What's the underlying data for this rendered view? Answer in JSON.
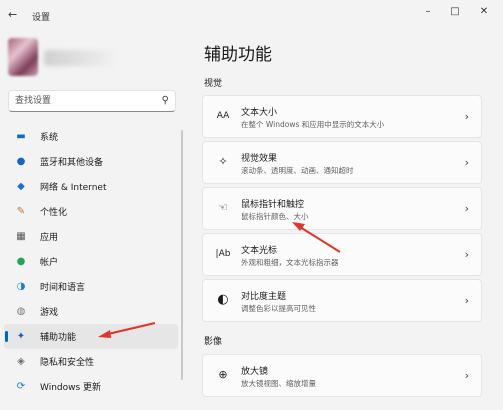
{
  "window": {
    "back_glyph": "←",
    "title": "设置",
    "minimize_glyph": "–",
    "maximize_glyph": "□",
    "close_glyph": "✕"
  },
  "search": {
    "placeholder": "查找设置",
    "icon": "search-icon"
  },
  "sidebar": {
    "items": [
      {
        "label": "系统",
        "icon": "monitor-icon",
        "glyph": "▬",
        "color": "#0f6cbd"
      },
      {
        "label": "蓝牙和其他设备",
        "icon": "bluetooth-icon",
        "glyph": "●",
        "color": "#1a64c4"
      },
      {
        "label": "网络 & Internet",
        "icon": "wifi-icon",
        "glyph": "◆",
        "color": "#1f6fd1"
      },
      {
        "label": "个性化",
        "icon": "brush-icon",
        "glyph": "✎",
        "color": "#c8722f"
      },
      {
        "label": "应用",
        "icon": "apps-icon",
        "glyph": "▦",
        "color": "#555555"
      },
      {
        "label": "帐户",
        "icon": "person-icon",
        "glyph": "●",
        "color": "#25a35a"
      },
      {
        "label": "时间和语言",
        "icon": "globe-icon",
        "glyph": "◑",
        "color": "#1e78d4"
      },
      {
        "label": "游戏",
        "icon": "gamepad-icon",
        "glyph": "◍",
        "color": "#7a7a7a"
      },
      {
        "label": "辅助功能",
        "icon": "accessibility-icon",
        "glyph": "✦",
        "color": "#1a5fb4",
        "active": true
      },
      {
        "label": "隐私和安全性",
        "icon": "shield-icon",
        "glyph": "◈",
        "color": "#6b6b6b"
      },
      {
        "label": "Windows 更新",
        "icon": "update-icon",
        "glyph": "⟳",
        "color": "#1e78d4"
      }
    ]
  },
  "main": {
    "title": "辅助功能",
    "sections": [
      {
        "label": "视觉",
        "items": [
          {
            "title": "文本大小",
            "subtitle": "在整个 Windows 和应用中显示的文本大小",
            "icon": "text-size-icon",
            "glyph": "AA"
          },
          {
            "title": "视觉效果",
            "subtitle": "滚动条、透明度、动画、通知超时",
            "icon": "sparkle-icon",
            "glyph": "✧"
          },
          {
            "title": "鼠标指针和触控",
            "subtitle": "鼠标指针颜色、大小",
            "icon": "pointer-icon",
            "glyph": "☜"
          },
          {
            "title": "文本光标",
            "subtitle": "外观和粗细，文本光标指示器",
            "icon": "text-cursor-icon",
            "glyph": "|Ab"
          },
          {
            "title": "对比度主题",
            "subtitle": "调整色彩以提高可见性",
            "icon": "contrast-icon",
            "glyph": "◐"
          }
        ]
      },
      {
        "label": "影像",
        "items": [
          {
            "title": "放大镜",
            "subtitle": "放大镜视图、缩放增量",
            "icon": "magnifier-icon",
            "glyph": "⊕"
          }
        ]
      }
    ],
    "chevron": "›"
  },
  "annotations": {
    "arrow_color": "#e0352b"
  }
}
